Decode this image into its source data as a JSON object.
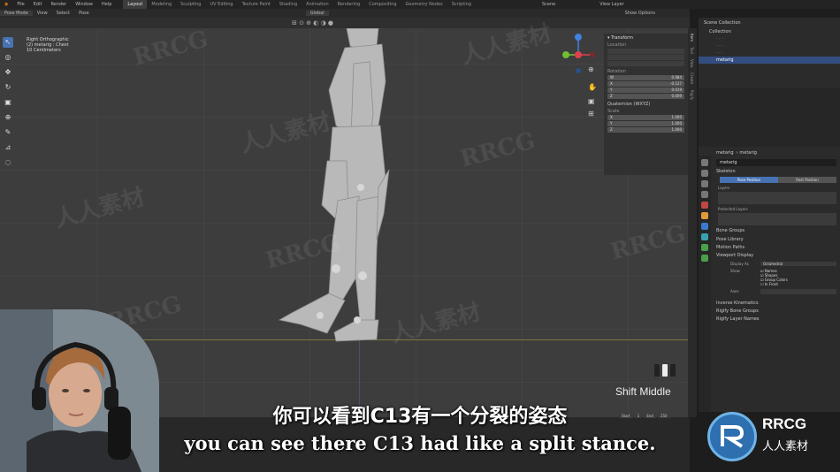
{
  "topbar": {
    "menus": [
      "File",
      "Edit",
      "Render",
      "Window",
      "Help"
    ],
    "workspaces": [
      "Layout",
      "Modeling",
      "Sculpting",
      "UV Editing",
      "Texture Paint",
      "Shading",
      "Animation",
      "Rendering",
      "Compositing",
      "Geometry Nodes",
      "Scripting"
    ],
    "scene": "Scene",
    "view_layer": "View Layer"
  },
  "header": {
    "mode": "Pose Mode",
    "menus": [
      "View",
      "Select",
      "Pose"
    ],
    "orientation": "Global",
    "options": "Show Options"
  },
  "viewport": {
    "view_name": "Right Orthographic",
    "object": "(2) metarig : Chest",
    "scale": "10 Centimeters"
  },
  "npanel": {
    "title": "Transform",
    "location_label": "Location",
    "rotation_label": "Rotation",
    "rotation": [
      {
        "axis": "W",
        "value": "0.984"
      },
      {
        "axis": "X",
        "value": "-0.127"
      },
      {
        "axis": "Y",
        "value": "0.019"
      },
      {
        "axis": "Z",
        "value": "0.009"
      }
    ],
    "rotation_mode": "Quaternion (WXYZ)",
    "scale_label": "Scale",
    "scale": [
      {
        "axis": "X",
        "value": "1.000"
      },
      {
        "axis": "Y",
        "value": "1.000"
      },
      {
        "axis": "Z",
        "value": "1.000"
      }
    ],
    "tabs": [
      "Item",
      "Tool",
      "View",
      "Create",
      "Rigify"
    ]
  },
  "outliner": {
    "title": "Scene Collection",
    "items": [
      "Collection",
      "metarig"
    ]
  },
  "properties": {
    "object": "metarig",
    "data": "metarig",
    "sections": [
      "Skeleton",
      "Bone Groups",
      "Pose Library",
      "Motion Paths",
      "Viewport Display"
    ],
    "pose_position": "Pose Position",
    "rest_position": "Rest Position",
    "layers": "Layers",
    "protected_layers": "Protected Layers",
    "display_as_label": "Display As",
    "display_as": "Octahedral",
    "show_label": "Show",
    "checks": [
      "Names",
      "Shapes",
      "Group Colors",
      "In Front"
    ],
    "axes_label": "Axes",
    "sections2": [
      "Inverse Kinematics",
      "Rigify Bone Groups",
      "Rigify Layer Names"
    ]
  },
  "timeline": {
    "start_label": "Start",
    "start": "1",
    "end_label": "End",
    "end": "250"
  },
  "overlay": {
    "key_hint": "Shift Middle",
    "subtitle_cn": "你可以看到C13有一个分裂的姿态",
    "subtitle_en": "you can see there C13 had like a split stance.",
    "watermark_en": "RRCG",
    "watermark_cn": "人人素材",
    "logo_en": "RRCG",
    "logo_cn": "人人素材"
  },
  "colors": {
    "accent": "#4772b3",
    "x_axis": "#e0404e",
    "y_axis": "#6fbf32",
    "z_axis": "#3f82e0"
  }
}
